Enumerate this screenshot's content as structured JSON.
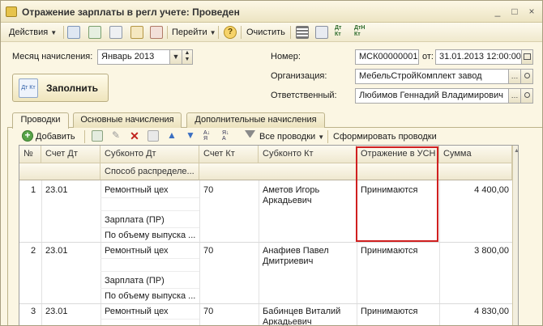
{
  "window": {
    "title": "Отражение зарплаты в регл учете: Проведен",
    "controls": {
      "minimize": "_",
      "maximize": "□",
      "close": "×"
    }
  },
  "toolbar": {
    "actions_label": "Действия",
    "goto_label": "Перейти",
    "help_label": "?",
    "clear_label": "Очистить",
    "dt_kt_label": "Дт Кт",
    "dt_kt_n_label": "ДтН Кт"
  },
  "form": {
    "month_label": "Месяц начисления:",
    "month_value": "Январь 2013",
    "number_label": "Номер:",
    "number_value": "МСК00000001",
    "date_label": "от:",
    "date_value": "31.01.2013 12:00:00",
    "org_label": "Организация:",
    "org_value": "МебельСтройКомплект завод",
    "resp_label": "Ответственный:",
    "resp_value": "Любимов Геннадий Владимирович",
    "fill_label": "Заполнить",
    "fill_icon_text": "Дт Кт"
  },
  "tabs": [
    {
      "label": "Проводки"
    },
    {
      "label": "Основные начисления"
    },
    {
      "label": "Дополнительные начисления"
    }
  ],
  "inner_toolbar": {
    "add_label": "Добавить",
    "all_postings_label": "Все проводки",
    "form_postings_label": "Сформировать проводки"
  },
  "table": {
    "headers": {
      "num": "№",
      "account_dt": "Счет Дт",
      "subconto_dt": "Субконто Дт",
      "distribution": "Способ распределе...",
      "account_kt": "Счет Кт",
      "subconto_kt": "Субконто Кт",
      "usn": "Отражение в УСН",
      "sum": "Сумма"
    },
    "rows": [
      {
        "num": "1",
        "account_dt": "23.01",
        "subconto_dt_1": "Ремонтный цех",
        "subconto_dt_2": "Зарплата (ПР)",
        "subconto_dt_3": "По объему выпуска ...",
        "account_kt": "70",
        "subconto_kt_1": "Аметов Игорь",
        "subconto_kt_2": "Аркадьевич",
        "usn": "Принимаются",
        "sum": "4 400,00"
      },
      {
        "num": "2",
        "account_dt": "23.01",
        "subconto_dt_1": "Ремонтный цех",
        "subconto_dt_2": "Зарплата (ПР)",
        "subconto_dt_3": "По объему выпуска ...",
        "account_kt": "70",
        "subconto_kt_1": "Анафиев Павел",
        "subconto_kt_2": "Дмитриевич",
        "usn": "Принимаются",
        "sum": "3 800,00"
      },
      {
        "num": "3",
        "account_dt": "23.01",
        "subconto_dt_1": "Ремонтный цех",
        "subconto_dt_2": "",
        "subconto_dt_3": "",
        "account_kt": "70",
        "subconto_kt_1": "Бабинцев Виталий",
        "subconto_kt_2": "Аркадьевич",
        "usn": "Принимаются",
        "sum": "4 830,00"
      }
    ]
  },
  "colors": {
    "highlight": "#d02020",
    "window_bg": "#fbf6e3"
  }
}
